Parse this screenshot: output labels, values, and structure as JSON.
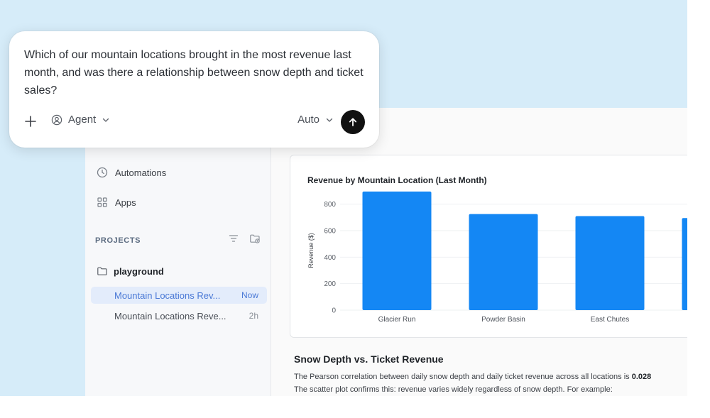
{
  "prompt": {
    "text": "Which of our mountain locations brought in the most revenue last month, and was there a relationship between snow depth and ticket sales?",
    "agent_label": "Agent",
    "model_label": "Auto"
  },
  "sidebar": {
    "nav": [
      {
        "label": "Automations",
        "icon": "clock-icon"
      },
      {
        "label": "Apps",
        "icon": "grid-icon"
      }
    ],
    "projects_label": "PROJECTS",
    "folder": "playground",
    "chats": [
      {
        "title": "Mountain Locations Rev...",
        "time": "Now",
        "active": true
      },
      {
        "title": "Mountain Locations Reve...",
        "time": "2h",
        "active": false
      }
    ]
  },
  "colors": {
    "bar": "#1487f4",
    "accent": "#4a79d6",
    "backdrop": "#d6ecf9"
  },
  "chart_data": {
    "type": "bar",
    "title": "Revenue by Mountain Location (Last Month)",
    "ylabel": "Revenue ($)",
    "xlabel": "",
    "categories": [
      "Glacier Run",
      "Powder Basin",
      "East Chutes",
      ""
    ],
    "values": [
      895,
      725,
      710,
      695
    ],
    "yticks": [
      0,
      200,
      400,
      600,
      800
    ],
    "ylim": [
      0,
      900
    ],
    "grid": true
  },
  "analysis": {
    "heading": "Snow Depth vs. Ticket Revenue",
    "line1": "The Pearson correlation between daily snow depth and daily ticket revenue across all locations is",
    "line1_value": "0.028",
    "line2": "The scatter plot confirms this: revenue varies widely regardless of snow depth. For example:"
  }
}
